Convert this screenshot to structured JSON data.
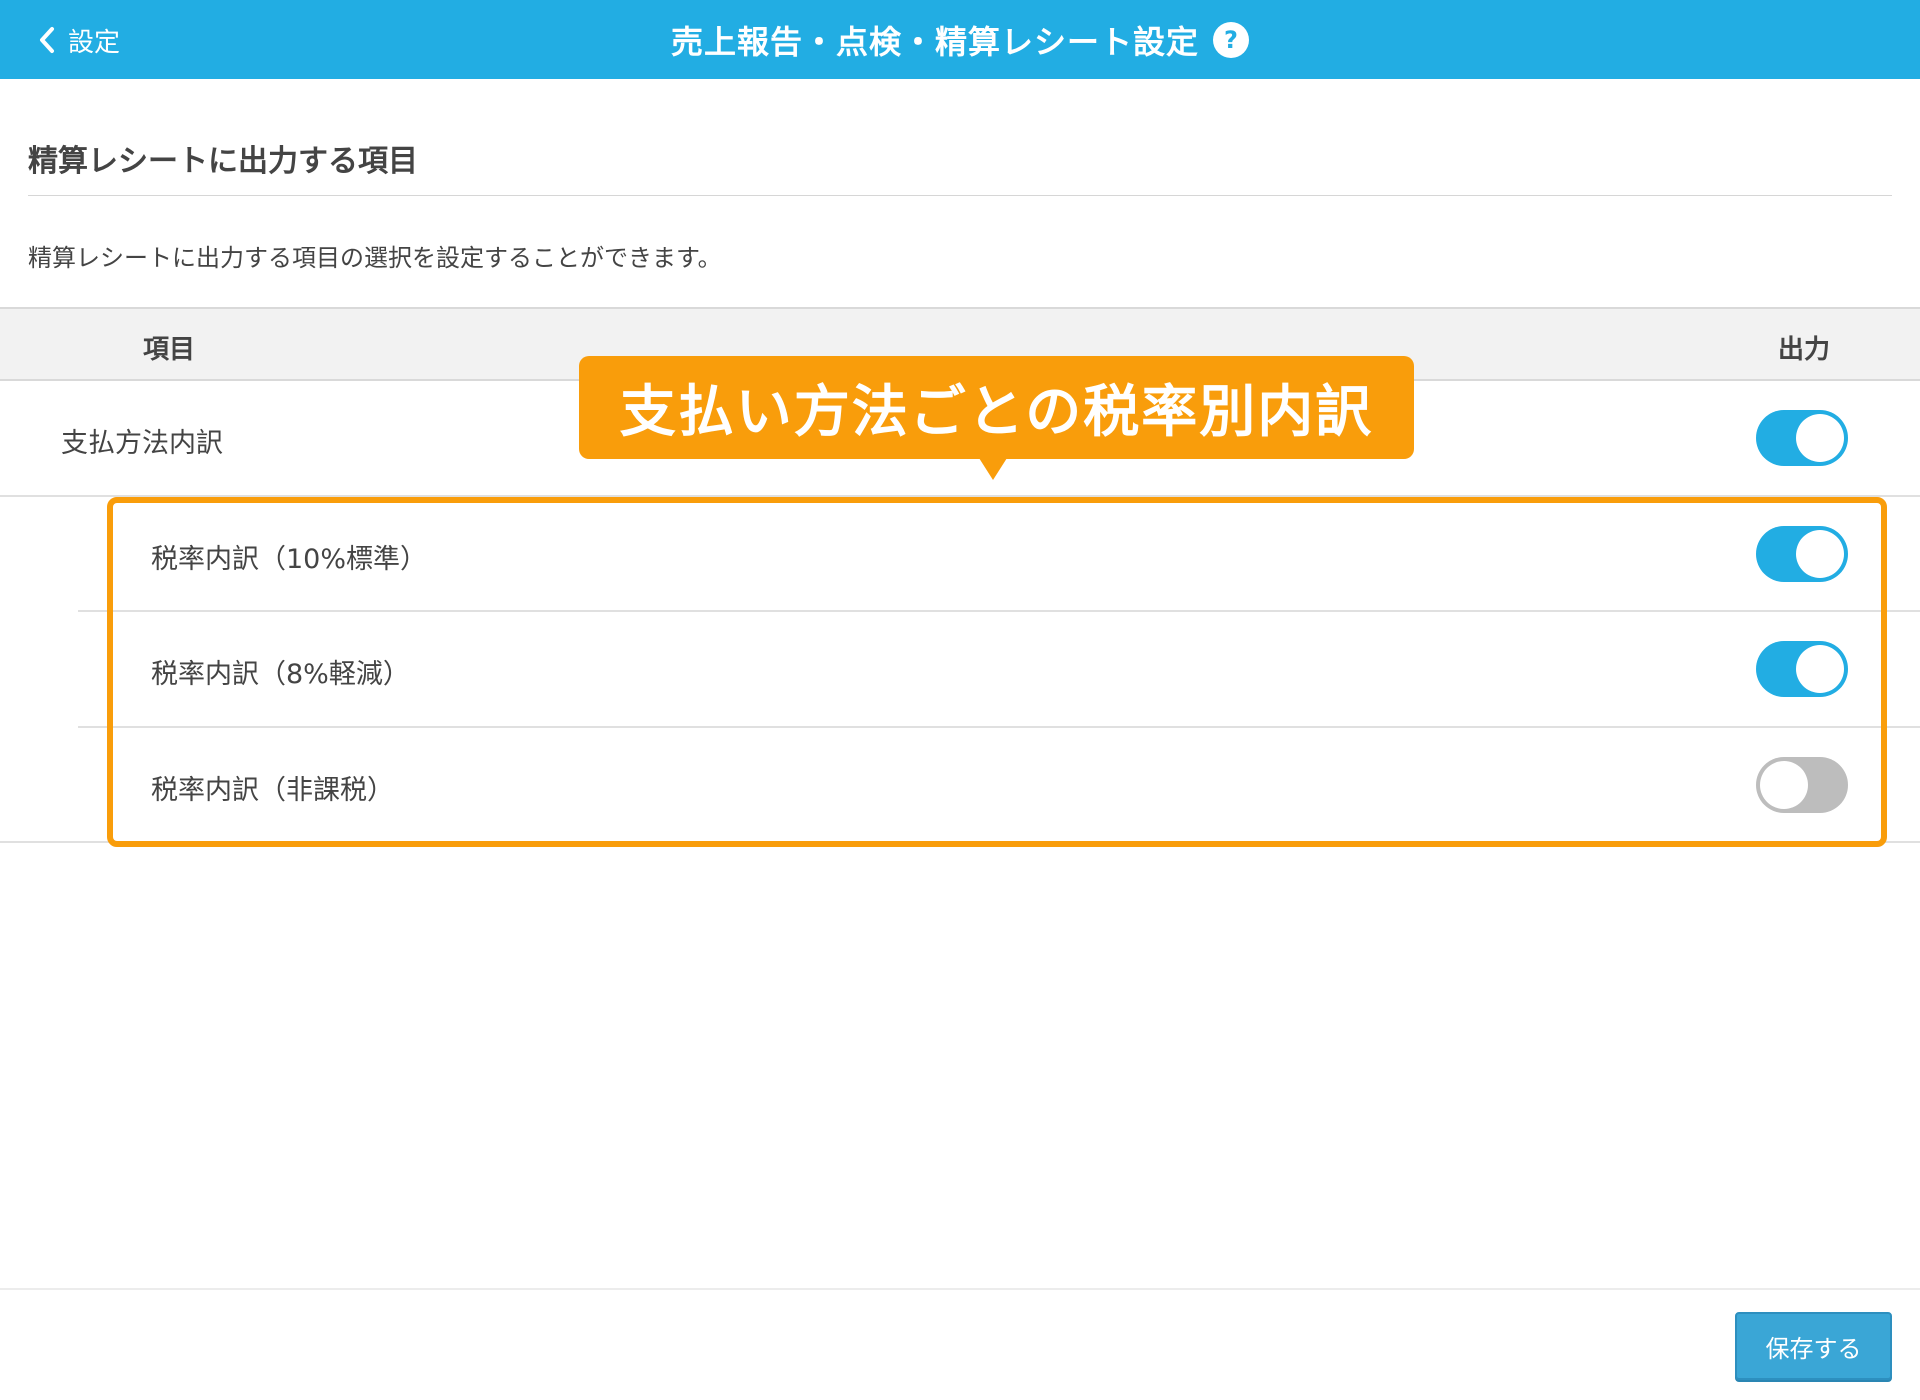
{
  "header": {
    "back_label": "設定",
    "title": "売上報告・点検・精算レシート設定",
    "help_symbol": "?"
  },
  "section": {
    "title": "精算レシートに出力する項目",
    "description": "精算レシートに出力する項目の選択を設定することができます。"
  },
  "table": {
    "col_item": "項目",
    "col_output": "出力",
    "rows": [
      {
        "label": "支払方法内訳",
        "enabled": true
      },
      {
        "label": "税率内訳（10%標準）",
        "enabled": true
      },
      {
        "label": "税率内訳（8%軽減）",
        "enabled": true
      },
      {
        "label": "税率内訳（非課税）",
        "enabled": false
      }
    ]
  },
  "callout": {
    "text": "支払い方法ごとの税率別内訳"
  },
  "footer": {
    "save_label": "保存する"
  },
  "colors": {
    "header_bg": "#22ade3",
    "toggle_on": "#22ade3",
    "toggle_off": "#bdbdbd",
    "callout": "#f99d0b"
  }
}
